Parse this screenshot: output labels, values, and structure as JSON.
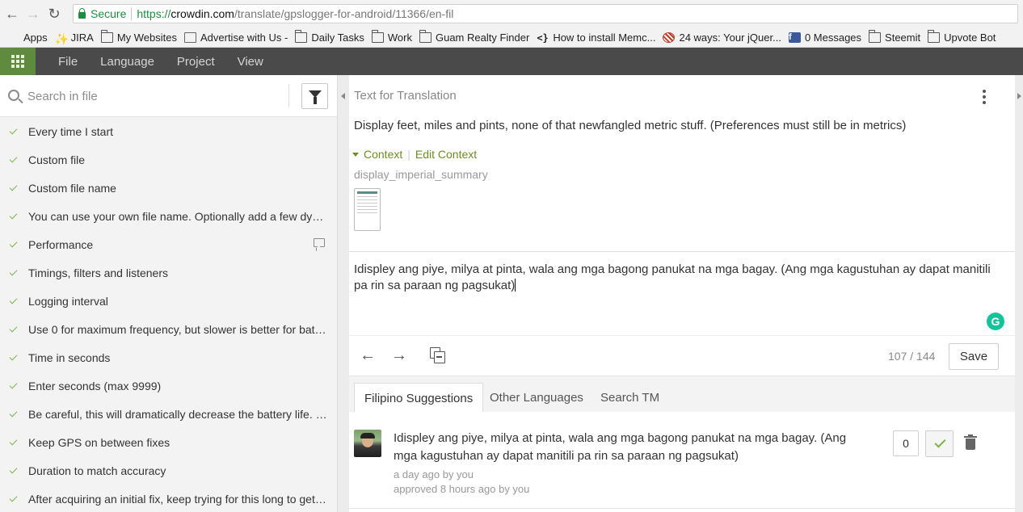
{
  "browser": {
    "secure_label": "Secure",
    "url_scheme": "https://",
    "url_host": "crowdin.com",
    "url_path": "/translate/gpslogger-for-android/11366/en-fil",
    "bookmarks": [
      {
        "label": "Apps",
        "icon": "apps-icon"
      },
      {
        "label": "JIRA",
        "icon": "jira-icon"
      },
      {
        "label": "My Websites",
        "icon": "folder-icon"
      },
      {
        "label": "Advertise with Us -",
        "icon": "page-icon"
      },
      {
        "label": "Daily Tasks",
        "icon": "folder-icon"
      },
      {
        "label": "Work",
        "icon": "folder-icon"
      },
      {
        "label": "Guam Realty Finder",
        "icon": "folder-icon"
      },
      {
        "label": "How to install Memc...",
        "icon": "code-icon"
      },
      {
        "label": "24 ways: Your jQuer...",
        "icon": "ways-icon"
      },
      {
        "label": "0 Messages",
        "icon": "facebook-icon"
      },
      {
        "label": "Steemit",
        "icon": "folder-icon"
      },
      {
        "label": "Upvote Bot",
        "icon": "folder-icon"
      }
    ]
  },
  "toolbar": {
    "menu": [
      "File",
      "Language",
      "Project",
      "View"
    ]
  },
  "left_panel": {
    "search_placeholder": "Search in file",
    "strings": [
      {
        "text": "Every time I start",
        "has_comment": false
      },
      {
        "text": "Custom file",
        "has_comment": false
      },
      {
        "text": "Custom file name",
        "has_comment": false
      },
      {
        "text": "You can use your own file name. Optionally add a few dyna...",
        "has_comment": false
      },
      {
        "text": "Performance",
        "has_comment": true
      },
      {
        "text": "Timings, filters and listeners",
        "has_comment": false
      },
      {
        "text": "Logging interval",
        "has_comment": false
      },
      {
        "text": "Use 0 for maximum frequency, but slower is better for batt...",
        "has_comment": false
      },
      {
        "text": "Time in seconds",
        "has_comment": false
      },
      {
        "text": "Enter seconds (max 9999)",
        "has_comment": false
      },
      {
        "text": "Be careful, this will dramatically decrease the battery life. U...",
        "has_comment": false
      },
      {
        "text": "Keep GPS on between fixes",
        "has_comment": false
      },
      {
        "text": "Duration to match accuracy",
        "has_comment": false
      },
      {
        "text": "After acquiring an initial fix, keep trying for this long to get ...",
        "has_comment": false
      }
    ]
  },
  "editor": {
    "header": "Text for Translation",
    "source_text": "Display feet, miles and pints, none of that newfangled metric stuff. (Preferences must still be in metrics)",
    "context_label": "Context",
    "edit_context_label": "Edit Context",
    "string_key": "display_imperial_summary",
    "translation": "Idispley ang piye, milya at pinta, wala ang mga bagong panukat na mga bagay. (Ang mga kagustuhan ay dapat manitili pa rin sa paraan ng pagsukat)",
    "counter": "107 / 144",
    "save_label": "Save",
    "grammarly_letter": "G"
  },
  "suggestions": {
    "tabs": [
      "Filipino Suggestions",
      "Other Languages",
      "Search TM"
    ],
    "active_tab": 0,
    "items": [
      {
        "text": "Idispley ang piye, milya at pinta, wala ang mga bagong panukat na mga bagay. (Ang mga kagustuhan ay dapat manitili pa rin sa paraan ng pagsukat)",
        "created": "a day ago by you",
        "approved": "approved 8 hours ago by you",
        "votes": "0"
      }
    ]
  },
  "colors": {
    "accent_green": "#6b8e23",
    "check_green": "#7ab648",
    "toolbar_bg": "#4a4a4a",
    "grid_btn_bg": "#5e8b3d"
  }
}
